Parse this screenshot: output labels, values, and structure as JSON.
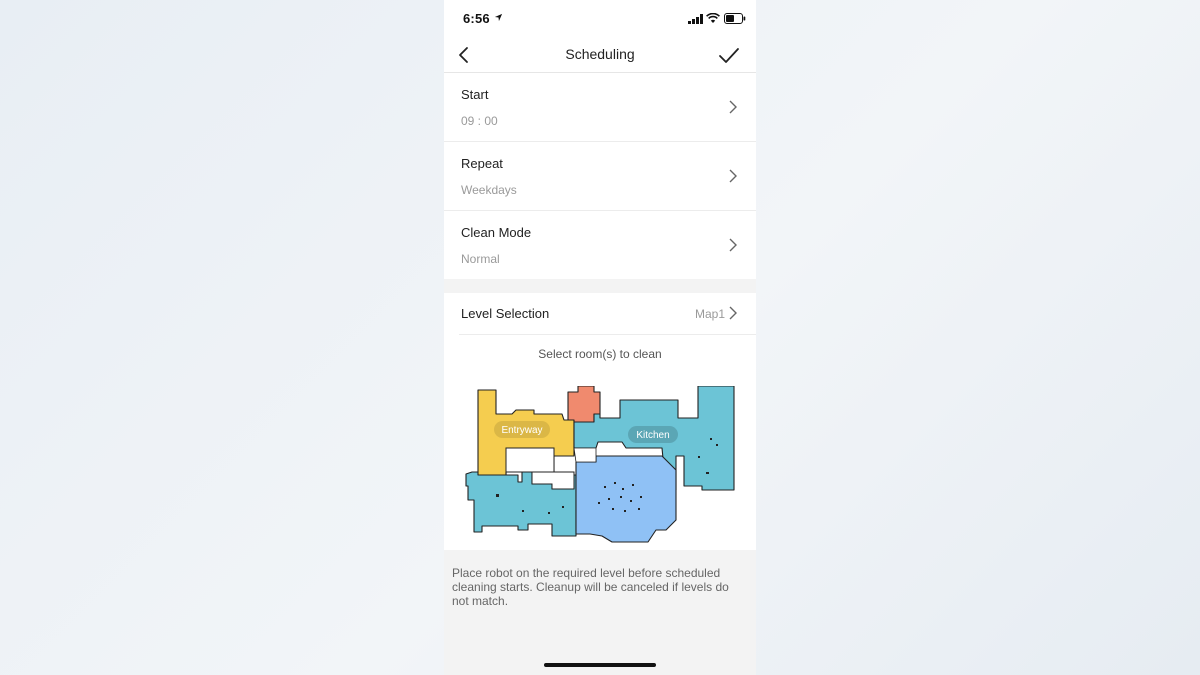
{
  "status_bar": {
    "time": "6:56",
    "icons": [
      "location-arrow-icon",
      "cellular-signal-icon",
      "wifi-icon",
      "battery-icon"
    ]
  },
  "nav": {
    "title": "Scheduling",
    "back_icon": "chevron-left-icon",
    "confirm_icon": "checkmark-icon"
  },
  "settings": [
    {
      "label": "Start",
      "value": "09 : 00"
    },
    {
      "label": "Repeat",
      "value": "Weekdays"
    },
    {
      "label": "Clean Mode",
      "value": "Normal"
    }
  ],
  "level": {
    "label": "Level Selection",
    "value": "Map1"
  },
  "map": {
    "hint": "Select room(s) to clean",
    "rooms": [
      {
        "name": "Entryway",
        "color": "#f5cd4f"
      },
      {
        "name": "Kitchen",
        "color": "#6cc4d6"
      }
    ],
    "unlabeled_room_colors": [
      "#f08a6e",
      "#8fc1f5",
      "#6cc4d6"
    ]
  },
  "notice": "Place robot on the required level before scheduled cleaning starts. Cleanup will be canceled if levels do not match.",
  "colors": {
    "background": "#f3f3f3",
    "card": "#ffffff",
    "secondary_text": "#9a9a9a"
  }
}
